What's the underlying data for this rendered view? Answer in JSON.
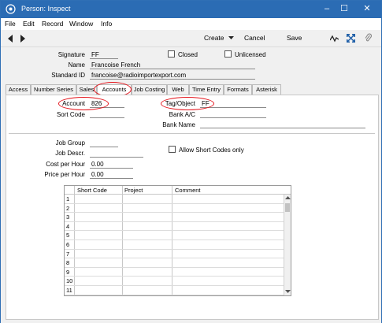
{
  "window": {
    "title": "Person: Inspect",
    "accent": "#2b6cb4"
  },
  "menubar": [
    "File",
    "Edit",
    "Record",
    "Window",
    "Info"
  ],
  "toolbar": {
    "create_label": "Create",
    "cancel_label": "Cancel",
    "save_label": "Save"
  },
  "header": {
    "signature_label": "Signature",
    "signature_value": "FF",
    "closed_label": "Closed",
    "unlicensed_label": "Unlicensed",
    "name_label": "Name",
    "name_value": "Francoise French",
    "standard_id_label": "Standard ID",
    "standard_id_value": "francoise@radioimportexport.com"
  },
  "tabs": [
    "Access",
    "Number Series",
    "Sales",
    "Accounts",
    "Job Costing",
    "Web",
    "Time Entry",
    "Formats",
    "Asterisk"
  ],
  "active_tab": "Accounts",
  "accounts": {
    "account_label": "Account",
    "account_value": "826",
    "tag_label": "Tag/Object",
    "tag_value": "FF",
    "sort_code_label": "Sort Code",
    "bank_ac_label": "Bank A/C",
    "bank_name_label": "Bank Name",
    "job_group_label": "Job Group",
    "job_descr_label": "Job Descr.",
    "cost_per_hour_label": "Cost per Hour",
    "cost_per_hour_value": "0.00",
    "price_per_hour_label": "Price per Hour",
    "price_per_hour_value": "0.00",
    "allow_short_codes_label": "Allow Short Codes only"
  },
  "grid": {
    "columns": [
      "Short Code",
      "Project",
      "Comment"
    ],
    "rows": [
      "1",
      "2",
      "3",
      "4",
      "5",
      "6",
      "7",
      "8",
      "9",
      "10",
      "11"
    ]
  }
}
